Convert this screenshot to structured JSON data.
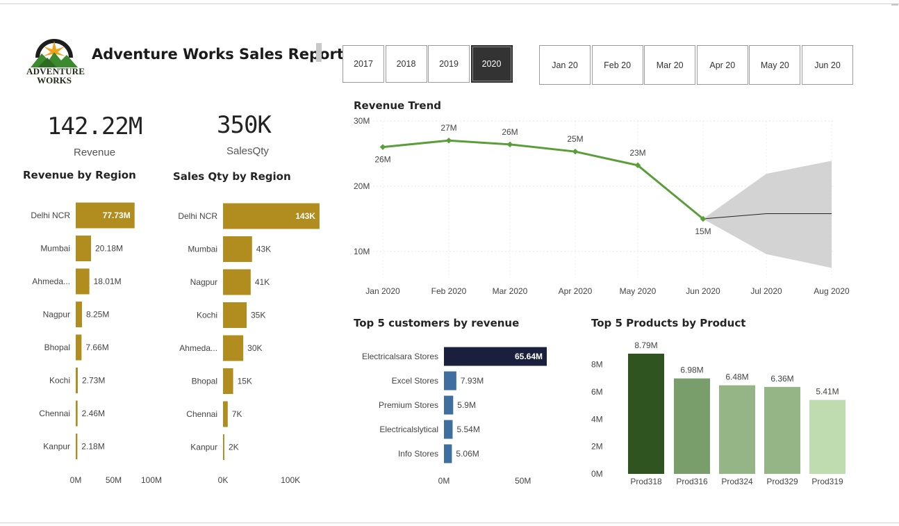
{
  "header": {
    "logo_line1": "ADVENTURE",
    "logo_line2": "WORKS",
    "title": "Adventure Works Sales Report"
  },
  "year_buttons": [
    {
      "label": "2017",
      "selected": false
    },
    {
      "label": "2018",
      "selected": false
    },
    {
      "label": "2019",
      "selected": false
    },
    {
      "label": "2020",
      "selected": true
    }
  ],
  "month_buttons": [
    {
      "label": "Jan 20"
    },
    {
      "label": "Feb 20"
    },
    {
      "label": "Mar 20"
    },
    {
      "label": "Apr 20"
    },
    {
      "label": "May 20"
    },
    {
      "label": "Jun 20"
    }
  ],
  "kpis": {
    "revenue": {
      "value": "142.22M",
      "label": "Revenue"
    },
    "salesqty": {
      "value": "350K",
      "label": "SalesQty"
    }
  },
  "colors": {
    "gold": "#b08d1e",
    "trend_green": "#5a9e3a",
    "forecast_band": "#d3d3d3",
    "customer_top": "#1a1f3d",
    "customer_bar": "#3f6fa0",
    "product_greens": [
      "#2f5420",
      "#7a9d6c",
      "#95b586",
      "#95b586",
      "#bfdcb0"
    ]
  },
  "chart_data": [
    {
      "type": "bar",
      "orientation": "horizontal",
      "title": "Revenue by Region",
      "categories": [
        "Delhi NCR",
        "Mumbai",
        "Ahmeda...",
        "Nagpur",
        "Bhopal",
        "Kochi",
        "Chennai",
        "Kanpur"
      ],
      "values": [
        77.73,
        20.18,
        18.01,
        8.25,
        7.66,
        2.73,
        2.46,
        2.18
      ],
      "data_labels": [
        "77.73M",
        "20.18M",
        "18.01M",
        "8.25M",
        "7.66M",
        "2.73M",
        "2.46M",
        "2.18M"
      ],
      "x_ticks": [
        "0M",
        "50M",
        "100M"
      ],
      "xlim": [
        0,
        100
      ]
    },
    {
      "type": "bar",
      "orientation": "horizontal",
      "title": "Sales Qty by Region",
      "categories": [
        "Delhi NCR",
        "Mumbai",
        "Nagpur",
        "Kochi",
        "Ahmeda...",
        "Bhopal",
        "Chennai",
        "Kanpur"
      ],
      "values": [
        143,
        43,
        41,
        35,
        30,
        15,
        7,
        2
      ],
      "data_labels": [
        "143K",
        "43K",
        "41K",
        "35K",
        "30K",
        "15K",
        "7K",
        "2K"
      ],
      "x_ticks": [
        "0K",
        "100K"
      ],
      "xlim": [
        0,
        140
      ]
    },
    {
      "type": "line",
      "title": "Revenue Trend",
      "x": [
        "Jan 2020",
        "Feb 2020",
        "Mar 2020",
        "Apr 2020",
        "May 2020",
        "Jun 2020",
        "Jul 2020",
        "Aug 2020"
      ],
      "values": [
        26,
        27,
        26.4,
        25.3,
        23.2,
        15
      ],
      "data_labels": [
        "26M",
        "27M",
        "26M",
        "25M",
        "23M",
        "15M"
      ],
      "forecast": {
        "x_index": [
          5,
          6,
          7
        ],
        "values": [
          15,
          15.8,
          15.8
        ],
        "upper": [
          15,
          21.9,
          23.9
        ],
        "lower": [
          15,
          9.6,
          7.5
        ]
      },
      "y_ticks": [
        "10M",
        "20M",
        "30M"
      ],
      "ylim": [
        5,
        30
      ],
      "grid": true
    },
    {
      "type": "bar",
      "orientation": "horizontal",
      "title": "Top 5 customers by revenue",
      "categories": [
        "Electricalsara Stores",
        "Excel Stores",
        "Premium Stores",
        "Electricalslytical",
        "Info Stores"
      ],
      "values": [
        65.64,
        7.93,
        5.9,
        5.54,
        5.06
      ],
      "data_labels": [
        "65.64M",
        "7.93M",
        "5.9M",
        "5.54M",
        "5.06M"
      ],
      "x_ticks": [
        "0M",
        "50M"
      ],
      "xlim": [
        0,
        65.64
      ]
    },
    {
      "type": "bar",
      "orientation": "vertical",
      "title": "Top 5 Products by Product",
      "categories": [
        "Prod318",
        "Prod316",
        "Prod324",
        "Prod329",
        "Prod319"
      ],
      "values": [
        8.79,
        6.98,
        6.48,
        6.36,
        5.41
      ],
      "data_labels": [
        "8.79M",
        "6.98M",
        "6.48M",
        "6.36M",
        "5.41M"
      ],
      "y_ticks": [
        "0M",
        "2M",
        "4M",
        "6M",
        "8M"
      ],
      "ylim": [
        0,
        8.79
      ]
    }
  ]
}
